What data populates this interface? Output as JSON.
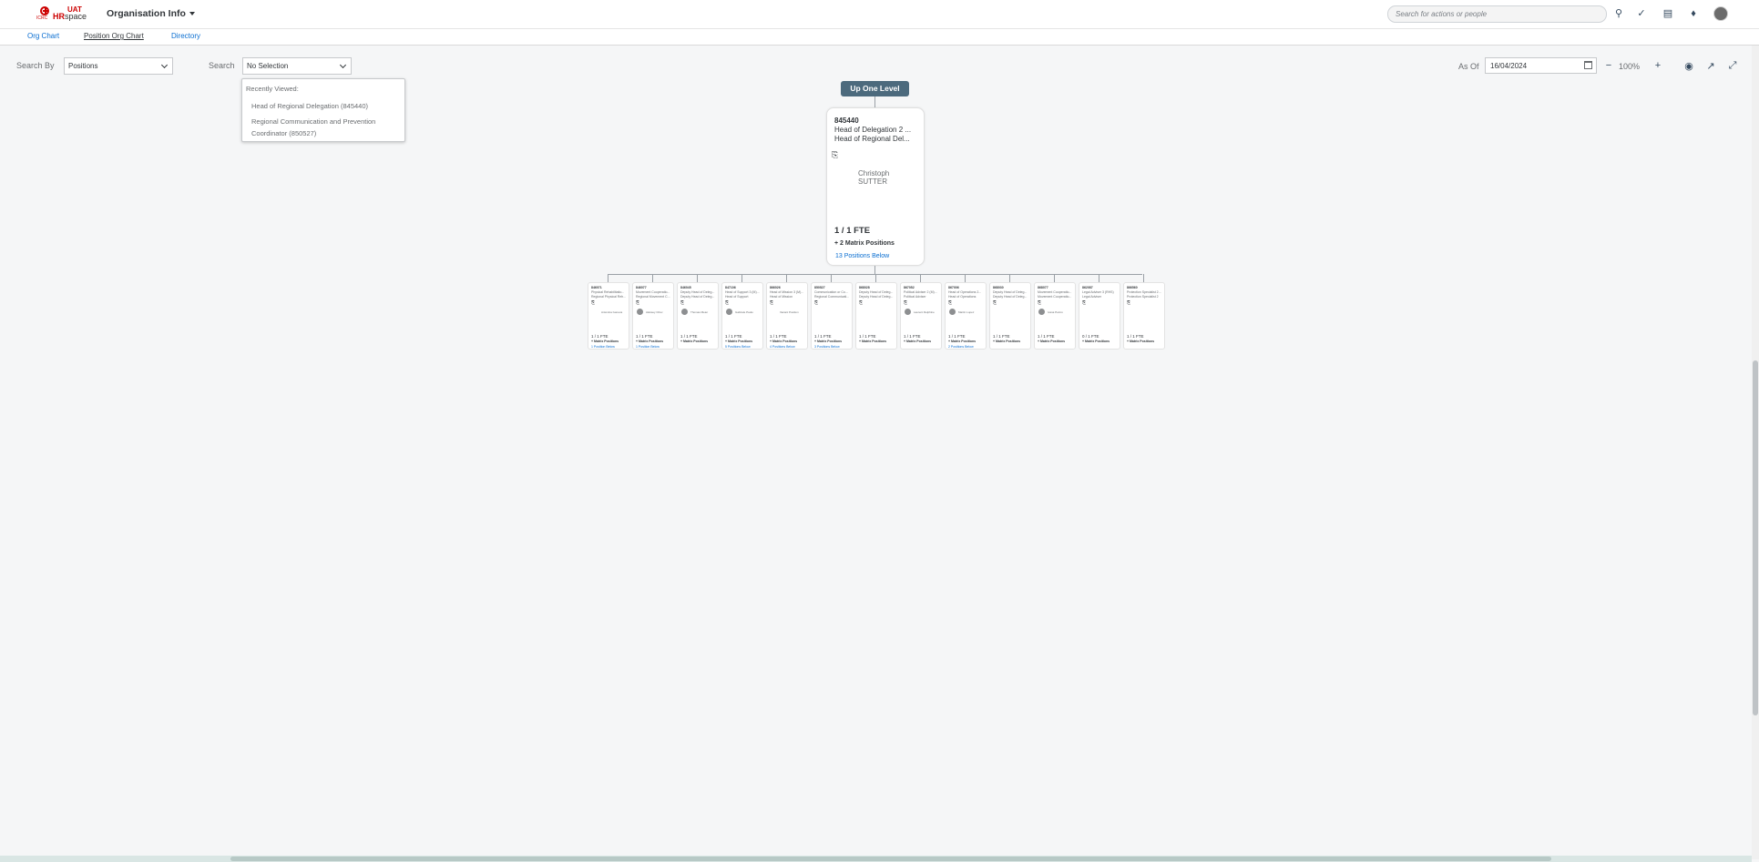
{
  "header": {
    "logo_small": "ICRC",
    "logo_uat": "UAT",
    "logo_hr": "HR",
    "logo_space": "space",
    "app_title": "Organisation Info",
    "search_placeholder": "Search for actions or people"
  },
  "tabs": [
    "Org Chart",
    "Position Org Chart",
    "Directory"
  ],
  "active_tab": "Position Org Chart",
  "toolbar": {
    "search_by_label": "Search By",
    "search_by_value": "Positions",
    "search_label": "Search",
    "search_value": "No Selection",
    "as_of_label": "As Of",
    "as_of_date": "16/04/2024",
    "zoom": "100%"
  },
  "dropdown": {
    "header": "Recently Viewed:",
    "items": [
      "Head of Regional Delegation (845440)",
      "Regional Communication and Prevention Coordinator (850527)"
    ]
  },
  "up_one_level": "Up One Level",
  "main_position": {
    "id": "845440",
    "title_line1": "Head of Delegation 2 ...",
    "title_line2": "Head of Regional Del...",
    "holder_first": "Christoph",
    "holder_last": "SUTTER",
    "fte": "1 / 1 FTE",
    "matrix": "+ 2 Matrix Positions",
    "below": "13 Positions Below"
  },
  "sub_positions": [
    {
      "id": "846071",
      "t1": "Physical Rehabilitatio...",
      "t2": "Regional Physical Reh...",
      "name": "Antonina Ivanova",
      "avatar": false,
      "fte": "1 / 1 FTE",
      "below": "1 Position Below"
    },
    {
      "id": "846077",
      "t1": "Movement Cooperatio...",
      "t2": "Regional Movement C...",
      "name": "Aleksey Orlov",
      "avatar": true,
      "fte": "1 / 1 FTE",
      "below": "1 Position Below"
    },
    {
      "id": "846045",
      "t1": "Deputy Head of Deleg...",
      "t2": "Deputy Head of Deleg...",
      "name": "Thomas Meier",
      "avatar": true,
      "fte": "1 / 1 FTE",
      "below": ""
    },
    {
      "id": "847106",
      "t1": "Head of Support 3 (M)...",
      "t2": "Head of Support",
      "name": "Gabriele Paulo",
      "avatar": true,
      "fte": "1 / 1 FTE",
      "below": "5 Positions Below"
    },
    {
      "id": "866026",
      "t1": "Head of Mission 3 (M)...",
      "t2": "Head of Mission",
      "name": "Vacant Position",
      "avatar": false,
      "fte": "1 / 1 FTE",
      "below": "4 Positions Below"
    },
    {
      "id": "850527",
      "t1": "Communication or Co...",
      "t2": "Regional Communicati...",
      "name": "",
      "avatar": false,
      "fte": "1 / 1 FTE",
      "below": "3 Positions Below"
    },
    {
      "id": "868028",
      "t1": "Deputy Head of Deleg...",
      "t2": "Deputy Head of Deleg...",
      "name": "",
      "avatar": false,
      "fte": "1 / 1 FTE",
      "below": ""
    },
    {
      "id": "867052",
      "t1": "Political Adviser 2 (M)...",
      "t2": "Political Adviser",
      "name": "Laurent Delphine",
      "avatar": true,
      "fte": "1 / 1 FTE",
      "below": ""
    },
    {
      "id": "867006",
      "t1": "Head of Operations 2...",
      "t2": "Head of Operations",
      "name": "Martin Lopez",
      "avatar": true,
      "fte": "1 / 1 FTE",
      "below": "2 Positions Below"
    },
    {
      "id": "868030",
      "t1": "Deputy Head of Deleg...",
      "t2": "Deputy Head of Deleg...",
      "name": "",
      "avatar": false,
      "fte": "1 / 1 FTE",
      "below": ""
    },
    {
      "id": "868077",
      "t1": "Movement Cooperatio...",
      "t2": "Movement Cooperatio...",
      "name": "Ivana Petrov",
      "avatar": true,
      "fte": "1 / 1 FTE",
      "below": ""
    },
    {
      "id": "862087",
      "t1": "Legal Adviser 3 (RHS)",
      "t2": "Legal Adviser",
      "name": "",
      "avatar": false,
      "fte": "0 / 1 FTE",
      "below": ""
    },
    {
      "id": "866560",
      "t1": "Protection Specialist 2...",
      "t2": "Protection Specialist 2",
      "name": "",
      "avatar": false,
      "fte": "1 / 1 FTE",
      "below": ""
    }
  ]
}
